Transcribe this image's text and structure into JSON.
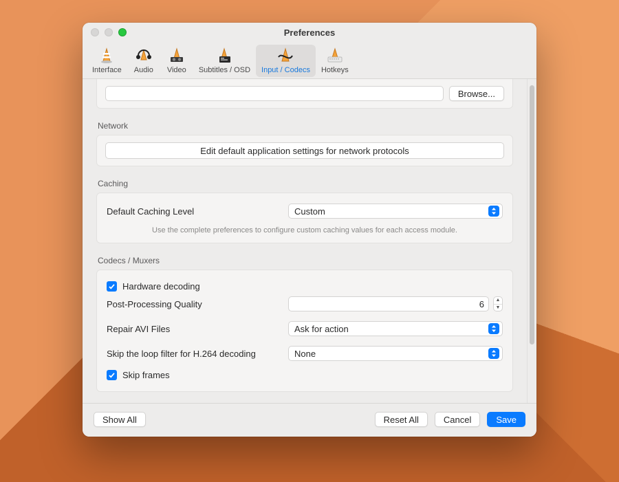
{
  "window": {
    "title": "Preferences"
  },
  "tabs": [
    {
      "label": "Interface"
    },
    {
      "label": "Audio"
    },
    {
      "label": "Video"
    },
    {
      "label": "Subtitles / OSD"
    },
    {
      "label": "Input / Codecs"
    },
    {
      "label": "Hotkeys"
    }
  ],
  "selected_tab": "Input / Codecs",
  "record_section": {
    "browse": "Browse..."
  },
  "network": {
    "header": "Network",
    "button": "Edit default application settings for network protocols"
  },
  "caching": {
    "header": "Caching",
    "label": "Default Caching Level",
    "value": "Custom",
    "hint": "Use the complete preferences to configure custom caching values for each access module."
  },
  "codecs": {
    "header": "Codecs / Muxers",
    "hw_decoding": {
      "label": "Hardware decoding",
      "checked": true
    },
    "postproc": {
      "label": "Post-Processing Quality",
      "value": "6"
    },
    "repair_avi": {
      "label": "Repair AVI Files",
      "value": "Ask for action"
    },
    "skip_loop": {
      "label": "Skip the loop filter for H.264 decoding",
      "value": "None"
    },
    "skip_frames": {
      "label": "Skip frames",
      "checked": true
    }
  },
  "footer": {
    "show_all": "Show All",
    "reset_all": "Reset All",
    "cancel": "Cancel",
    "save": "Save"
  }
}
